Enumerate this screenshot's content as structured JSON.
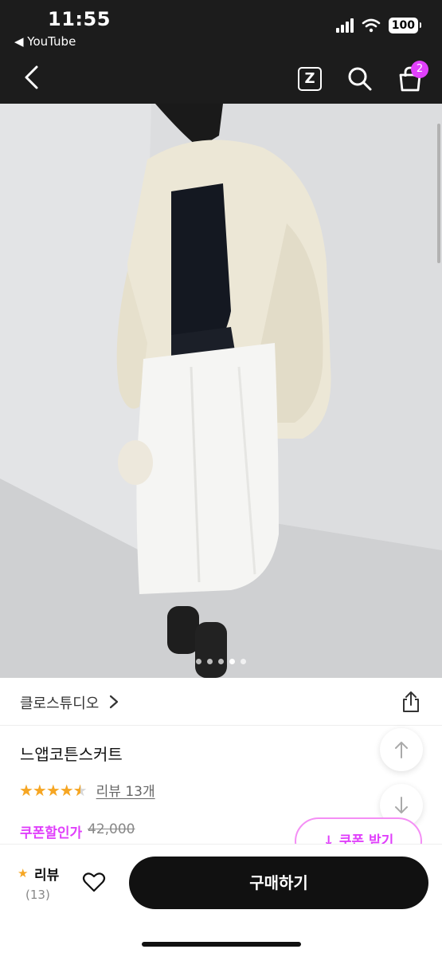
{
  "status_bar": {
    "time": "11:55",
    "back_app": "◀ YouTube",
    "battery": "100"
  },
  "header": {
    "back_icon": "chevron-left-icon",
    "z_label": "Z",
    "cart_badge": "2"
  },
  "gallery": {
    "total_images": 5,
    "active_index": 3
  },
  "brand": {
    "name": "클로스튜디오"
  },
  "product": {
    "title": "느앱코튼스커트",
    "rating_stars": 4.5,
    "review_link": "리뷰 13개",
    "coupon_label": "쿠폰할인가",
    "original_price": "42,000",
    "coupon_button": "↓ 쿠폰 받기"
  },
  "bottom_bar": {
    "review_label": "리뷰",
    "review_count": "(13)",
    "buy_label": "구매하기"
  },
  "colors": {
    "accent": "#e040fb",
    "star": "#f6a623",
    "header_bg": "#1c1c1c"
  }
}
